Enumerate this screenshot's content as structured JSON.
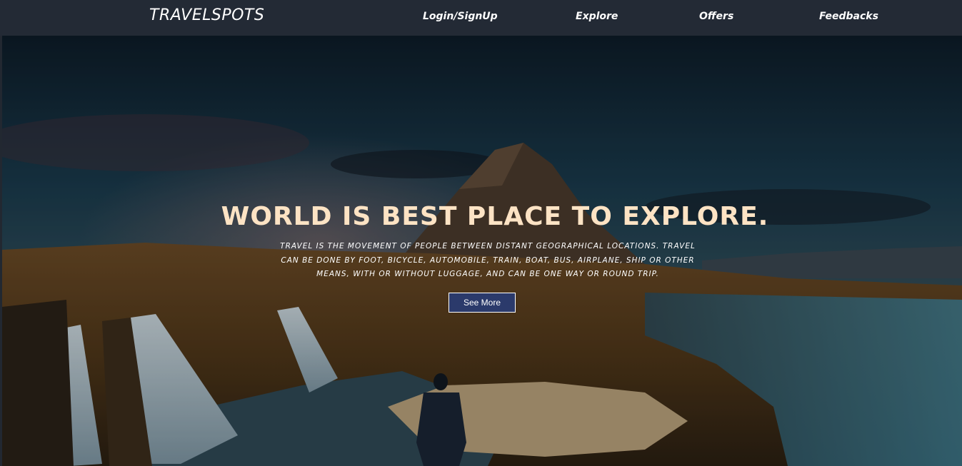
{
  "navbar": {
    "brand": "TRAVELSPOTS",
    "links": [
      {
        "label": "Login/SignUp"
      },
      {
        "label": "Explore"
      },
      {
        "label": "Offers"
      },
      {
        "label": "Feedbacks"
      }
    ],
    "background": "#232a35"
  },
  "hero": {
    "headline": "WORLD IS BEST PLACE TO EXPLORE.",
    "description": "Travel is the movement of people between distant geographical locations. Travel can be done by foot, bicycle, automobile, train, boat, bus, airplane, ship or other means, with or without luggage, and can be one way or round trip.",
    "cta_label": "See More",
    "colors": {
      "headline": "#fde3c4",
      "cta_background": "#2b3a6b"
    }
  }
}
